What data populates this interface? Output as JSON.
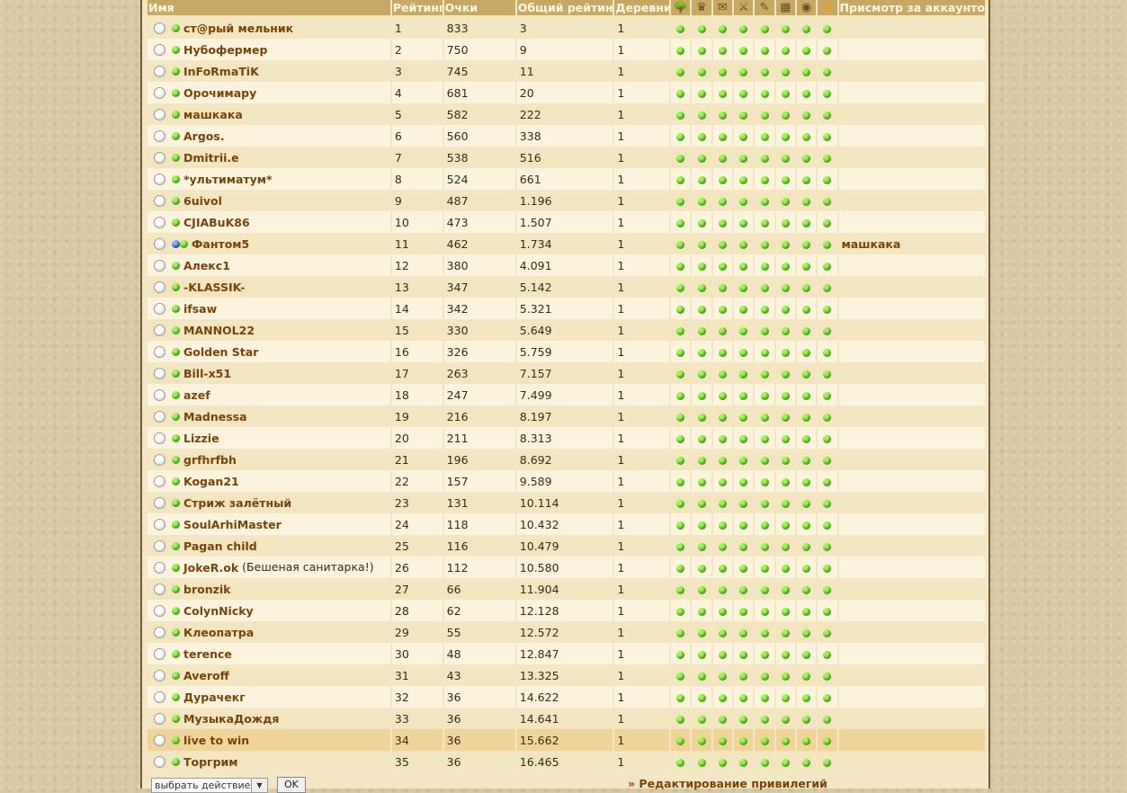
{
  "columns": {
    "name": "Имя",
    "rank": "Рейтинг",
    "points": "Очки",
    "overall_rank": "Общий рейтинг",
    "villages": "Деревни",
    "watch": "Присмотр за аккаунтом"
  },
  "privilege_icons": [
    "tree-icon",
    "crown-icon",
    "envelope-icon",
    "sword-icon",
    "scroll-icon",
    "calendar-icon",
    "eye-icon",
    "star-icon"
  ],
  "rows": [
    {
      "name": "ст@рый мельник",
      "rank": "1",
      "points": "833",
      "overall": "3",
      "villages": "1",
      "watch": ""
    },
    {
      "name": "Нубофермер",
      "rank": "2",
      "points": "750",
      "overall": "9",
      "villages": "1",
      "watch": ""
    },
    {
      "name": "InFoRmaTiK",
      "rank": "3",
      "points": "745",
      "overall": "11",
      "villages": "1",
      "watch": ""
    },
    {
      "name": "Орочимару",
      "rank": "4",
      "points": "681",
      "overall": "20",
      "villages": "1",
      "watch": ""
    },
    {
      "name": "машкака",
      "rank": "5",
      "points": "582",
      "overall": "222",
      "villages": "1",
      "watch": ""
    },
    {
      "name": "Argos.",
      "rank": "6",
      "points": "560",
      "overall": "338",
      "villages": "1",
      "watch": ""
    },
    {
      "name": "Dmitrii.e",
      "rank": "7",
      "points": "538",
      "overall": "516",
      "villages": "1",
      "watch": ""
    },
    {
      "name": "*ультиматум*",
      "rank": "8",
      "points": "524",
      "overall": "661",
      "villages": "1",
      "watch": ""
    },
    {
      "name": "6uivol",
      "rank": "9",
      "points": "487",
      "overall": "1.196",
      "villages": "1",
      "watch": ""
    },
    {
      "name": "CJIABuK86",
      "rank": "10",
      "points": "473",
      "overall": "1.507",
      "villages": "1",
      "watch": ""
    },
    {
      "name": "Фантом5",
      "rank": "11",
      "points": "462",
      "overall": "1.734",
      "villages": "1",
      "watch": "машкака",
      "watched": true
    },
    {
      "name": "Алекс1",
      "rank": "12",
      "points": "380",
      "overall": "4.091",
      "villages": "1",
      "watch": ""
    },
    {
      "name": "-KLASSIK-",
      "rank": "13",
      "points": "347",
      "overall": "5.142",
      "villages": "1",
      "watch": ""
    },
    {
      "name": "ifsaw",
      "rank": "14",
      "points": "342",
      "overall": "5.321",
      "villages": "1",
      "watch": ""
    },
    {
      "name": "MANNOL22",
      "rank": "15",
      "points": "330",
      "overall": "5.649",
      "villages": "1",
      "watch": ""
    },
    {
      "name": "Golden Star",
      "rank": "16",
      "points": "326",
      "overall": "5.759",
      "villages": "1",
      "watch": ""
    },
    {
      "name": "Bill-x51",
      "rank": "17",
      "points": "263",
      "overall": "7.157",
      "villages": "1",
      "watch": ""
    },
    {
      "name": "azef",
      "rank": "18",
      "points": "247",
      "overall": "7.499",
      "villages": "1",
      "watch": ""
    },
    {
      "name": "Madnessa",
      "rank": "19",
      "points": "216",
      "overall": "8.197",
      "villages": "1",
      "watch": ""
    },
    {
      "name": "Lizzie",
      "rank": "20",
      "points": "211",
      "overall": "8.313",
      "villages": "1",
      "watch": ""
    },
    {
      "name": "grfhrfbh",
      "rank": "21",
      "points": "196",
      "overall": "8.692",
      "villages": "1",
      "watch": ""
    },
    {
      "name": "Kogan21",
      "rank": "22",
      "points": "157",
      "overall": "9.589",
      "villages": "1",
      "watch": ""
    },
    {
      "name": "Стриж залётный",
      "rank": "23",
      "points": "131",
      "overall": "10.114",
      "villages": "1",
      "watch": ""
    },
    {
      "name": "SoulArhiMaster",
      "rank": "24",
      "points": "118",
      "overall": "10.432",
      "villages": "1",
      "watch": ""
    },
    {
      "name": "Pagan child",
      "rank": "25",
      "points": "116",
      "overall": "10.479",
      "villages": "1",
      "watch": ""
    },
    {
      "name": "JokeR.ok",
      "note": " (Бешеная санитарка!)",
      "rank": "26",
      "points": "112",
      "overall": "10.580",
      "villages": "1",
      "watch": ""
    },
    {
      "name": "bronzik",
      "rank": "27",
      "points": "66",
      "overall": "11.904",
      "villages": "1",
      "watch": ""
    },
    {
      "name": "ColynNicky",
      "rank": "28",
      "points": "62",
      "overall": "12.128",
      "villages": "1",
      "watch": ""
    },
    {
      "name": "Клеопатра",
      "rank": "29",
      "points": "55",
      "overall": "12.572",
      "villages": "1",
      "watch": ""
    },
    {
      "name": "terence",
      "rank": "30",
      "points": "48",
      "overall": "12.847",
      "villages": "1",
      "watch": ""
    },
    {
      "name": "Averoff",
      "rank": "31",
      "points": "43",
      "overall": "13.325",
      "villages": "1",
      "watch": ""
    },
    {
      "name": "Дурачекг",
      "rank": "32",
      "points": "36",
      "overall": "14.622",
      "villages": "1",
      "watch": ""
    },
    {
      "name": "МузыкаДождя",
      "rank": "33",
      "points": "36",
      "overall": "14.641",
      "villages": "1",
      "watch": ""
    },
    {
      "name": "live to win",
      "rank": "34",
      "points": "36",
      "overall": "15.662",
      "villages": "1",
      "watch": "",
      "own": true
    },
    {
      "name": "Торгрим",
      "rank": "35",
      "points": "36",
      "overall": "16.465",
      "villages": "1",
      "watch": ""
    }
  ],
  "footer": {
    "action_select": "выбрать действие...",
    "ok_label": "OK",
    "privileges_link": "» Редактирование привилегий"
  }
}
